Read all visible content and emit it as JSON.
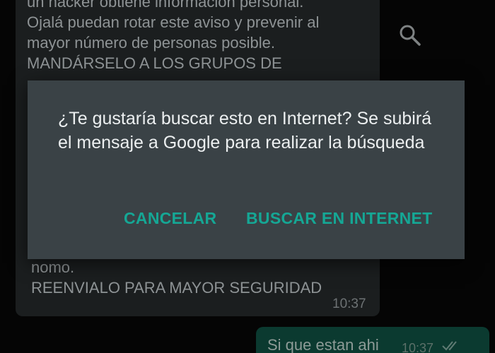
{
  "chat": {
    "incoming": {
      "text_top": "un hacker obtiene información  personal.\nOjalá puedan rotar este aviso y prevenir al\nmayor número de personas posible.\nMANDÁRSELO  A  LOS GRUPOS DE",
      "text_bottom": "nomo.\nREENVIALO PARA MAYOR SEGURIDAD",
      "time": "10:37"
    },
    "outgoing": {
      "text": "Si que estan ahi",
      "time": "10:37",
      "status_icon": "double-check-icon"
    },
    "header_icon": "search-icon"
  },
  "dialog": {
    "message": "¿Te gustaría buscar esto en Internet? Se subirá el mensaje a Google para realizar la búsqueda",
    "cancel_label": "CANCELAR",
    "confirm_label": "BUSCAR EN INTERNET"
  },
  "colors": {
    "dialog_bg": "#3a4246",
    "accent": "#15a795",
    "background": "#050505"
  }
}
